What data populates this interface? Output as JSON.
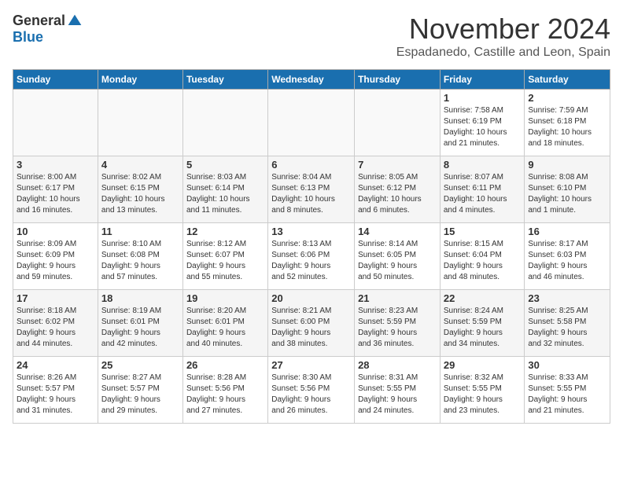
{
  "header": {
    "logo_general": "General",
    "logo_blue": "Blue",
    "month": "November 2024",
    "location": "Espadanedo, Castille and Leon, Spain"
  },
  "weekdays": [
    "Sunday",
    "Monday",
    "Tuesday",
    "Wednesday",
    "Thursday",
    "Friday",
    "Saturday"
  ],
  "weeks": [
    [
      {
        "day": "",
        "info": ""
      },
      {
        "day": "",
        "info": ""
      },
      {
        "day": "",
        "info": ""
      },
      {
        "day": "",
        "info": ""
      },
      {
        "day": "",
        "info": ""
      },
      {
        "day": "1",
        "info": "Sunrise: 7:58 AM\nSunset: 6:19 PM\nDaylight: 10 hours\nand 21 minutes."
      },
      {
        "day": "2",
        "info": "Sunrise: 7:59 AM\nSunset: 6:18 PM\nDaylight: 10 hours\nand 18 minutes."
      }
    ],
    [
      {
        "day": "3",
        "info": "Sunrise: 8:00 AM\nSunset: 6:17 PM\nDaylight: 10 hours\nand 16 minutes."
      },
      {
        "day": "4",
        "info": "Sunrise: 8:02 AM\nSunset: 6:15 PM\nDaylight: 10 hours\nand 13 minutes."
      },
      {
        "day": "5",
        "info": "Sunrise: 8:03 AM\nSunset: 6:14 PM\nDaylight: 10 hours\nand 11 minutes."
      },
      {
        "day": "6",
        "info": "Sunrise: 8:04 AM\nSunset: 6:13 PM\nDaylight: 10 hours\nand 8 minutes."
      },
      {
        "day": "7",
        "info": "Sunrise: 8:05 AM\nSunset: 6:12 PM\nDaylight: 10 hours\nand 6 minutes."
      },
      {
        "day": "8",
        "info": "Sunrise: 8:07 AM\nSunset: 6:11 PM\nDaylight: 10 hours\nand 4 minutes."
      },
      {
        "day": "9",
        "info": "Sunrise: 8:08 AM\nSunset: 6:10 PM\nDaylight: 10 hours\nand 1 minute."
      }
    ],
    [
      {
        "day": "10",
        "info": "Sunrise: 8:09 AM\nSunset: 6:09 PM\nDaylight: 9 hours\nand 59 minutes."
      },
      {
        "day": "11",
        "info": "Sunrise: 8:10 AM\nSunset: 6:08 PM\nDaylight: 9 hours\nand 57 minutes."
      },
      {
        "day": "12",
        "info": "Sunrise: 8:12 AM\nSunset: 6:07 PM\nDaylight: 9 hours\nand 55 minutes."
      },
      {
        "day": "13",
        "info": "Sunrise: 8:13 AM\nSunset: 6:06 PM\nDaylight: 9 hours\nand 52 minutes."
      },
      {
        "day": "14",
        "info": "Sunrise: 8:14 AM\nSunset: 6:05 PM\nDaylight: 9 hours\nand 50 minutes."
      },
      {
        "day": "15",
        "info": "Sunrise: 8:15 AM\nSunset: 6:04 PM\nDaylight: 9 hours\nand 48 minutes."
      },
      {
        "day": "16",
        "info": "Sunrise: 8:17 AM\nSunset: 6:03 PM\nDaylight: 9 hours\nand 46 minutes."
      }
    ],
    [
      {
        "day": "17",
        "info": "Sunrise: 8:18 AM\nSunset: 6:02 PM\nDaylight: 9 hours\nand 44 minutes."
      },
      {
        "day": "18",
        "info": "Sunrise: 8:19 AM\nSunset: 6:01 PM\nDaylight: 9 hours\nand 42 minutes."
      },
      {
        "day": "19",
        "info": "Sunrise: 8:20 AM\nSunset: 6:01 PM\nDaylight: 9 hours\nand 40 minutes."
      },
      {
        "day": "20",
        "info": "Sunrise: 8:21 AM\nSunset: 6:00 PM\nDaylight: 9 hours\nand 38 minutes."
      },
      {
        "day": "21",
        "info": "Sunrise: 8:23 AM\nSunset: 5:59 PM\nDaylight: 9 hours\nand 36 minutes."
      },
      {
        "day": "22",
        "info": "Sunrise: 8:24 AM\nSunset: 5:59 PM\nDaylight: 9 hours\nand 34 minutes."
      },
      {
        "day": "23",
        "info": "Sunrise: 8:25 AM\nSunset: 5:58 PM\nDaylight: 9 hours\nand 32 minutes."
      }
    ],
    [
      {
        "day": "24",
        "info": "Sunrise: 8:26 AM\nSunset: 5:57 PM\nDaylight: 9 hours\nand 31 minutes."
      },
      {
        "day": "25",
        "info": "Sunrise: 8:27 AM\nSunset: 5:57 PM\nDaylight: 9 hours\nand 29 minutes."
      },
      {
        "day": "26",
        "info": "Sunrise: 8:28 AM\nSunset: 5:56 PM\nDaylight: 9 hours\nand 27 minutes."
      },
      {
        "day": "27",
        "info": "Sunrise: 8:30 AM\nSunset: 5:56 PM\nDaylight: 9 hours\nand 26 minutes."
      },
      {
        "day": "28",
        "info": "Sunrise: 8:31 AM\nSunset: 5:55 PM\nDaylight: 9 hours\nand 24 minutes."
      },
      {
        "day": "29",
        "info": "Sunrise: 8:32 AM\nSunset: 5:55 PM\nDaylight: 9 hours\nand 23 minutes."
      },
      {
        "day": "30",
        "info": "Sunrise: 8:33 AM\nSunset: 5:55 PM\nDaylight: 9 hours\nand 21 minutes."
      }
    ]
  ]
}
